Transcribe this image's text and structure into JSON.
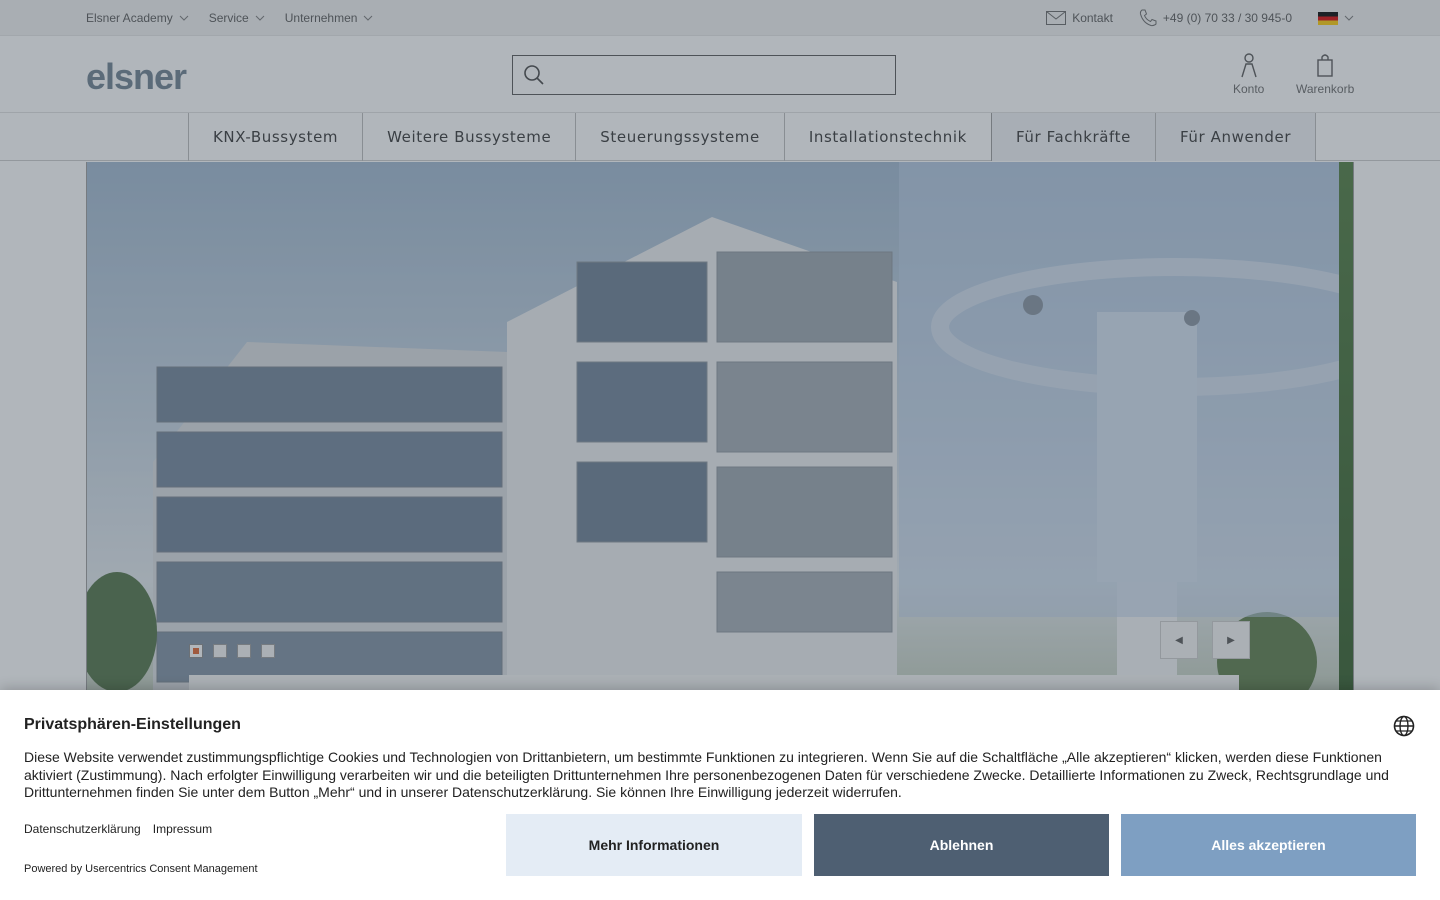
{
  "topbar": {
    "left_items": [
      {
        "label": "Elsner Academy"
      },
      {
        "label": "Service"
      },
      {
        "label": "Unternehmen"
      }
    ],
    "contact_label": "Kontakt",
    "phone_label": "+49 (0) 70 33 / 30 945-0",
    "language_icon": "flag-de-icon"
  },
  "header": {
    "logo_text": "elsner",
    "search": {
      "value": "",
      "placeholder": ""
    },
    "account_label": "Konto",
    "cart_label": "Warenkorb"
  },
  "nav": {
    "items": [
      {
        "label": "KNX-Bussystem"
      },
      {
        "label": "Weitere Bussysteme"
      },
      {
        "label": "Steuerungssysteme"
      },
      {
        "label": "Installationstechnik"
      },
      {
        "label": "Für Fachkräfte"
      },
      {
        "label": "Für Anwender"
      }
    ]
  },
  "hero": {
    "slide_count": 4,
    "active_slide": 1,
    "prev_icon": "◀",
    "next_icon": "▶"
  },
  "consent": {
    "title": "Privatsphären-Einstellungen",
    "text": "Diese Website verwendet zustimmungspflichtige Cookies und Technologien von Drittanbietern, um bestimmte Funktionen zu integrieren. Wenn Sie auf die Schaltfläche „Alle akzeptieren“ klicken, werden diese Funktionen aktiviert (Zustimmung). Nach erfolgter Einwilligung verarbeiten wir und die beteiligten Drittunternehmen Ihre personenbezogenen Daten für verschiedene Zwecke. Detaillierte Informationen zu Zweck, Rechtsgrundlage und Drittunternehmen finden Sie unter dem Button „Mehr“ und in unserer Datenschutzerklärung. Sie können Ihre Einwilligung jederzeit widerrufen.",
    "link_privacy": "Datenschutzerklärung",
    "link_imprint": "Impressum",
    "powered_by": "Powered by Usercentrics Consent Management",
    "btn_more": "Mehr Informationen",
    "btn_deny": "Ablehnen",
    "btn_accept": "Alles akzeptieren",
    "colors": {
      "more_bg": "#e4ecf5",
      "deny_bg": "#4e5f72",
      "accept_bg": "#7e9fc2"
    }
  }
}
